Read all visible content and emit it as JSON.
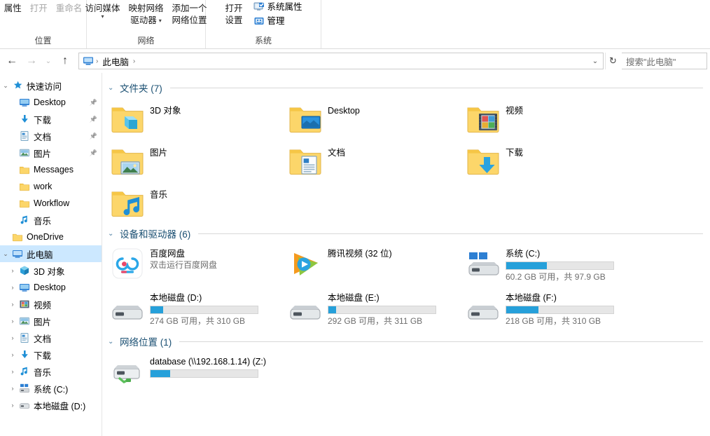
{
  "window": {
    "title": "此电脑"
  },
  "ribbon": {
    "groups": [
      {
        "name": "location",
        "label": "位置",
        "buttons": [
          {
            "label": "属性",
            "disabled": false,
            "has_caret": false
          },
          {
            "label": "打开",
            "disabled": true,
            "has_caret": false
          },
          {
            "label": "重命名",
            "disabled": true,
            "has_caret": false
          }
        ]
      },
      {
        "name": "network",
        "label": "网络",
        "buttons": [
          {
            "label_line1": "访问媒体",
            "label_line2": "",
            "has_caret": true
          },
          {
            "label_line1": "映射网络",
            "label_line2": "驱动器",
            "has_caret": true
          },
          {
            "label_line1": "添加一个",
            "label_line2": "网络位置",
            "has_caret": false
          }
        ]
      },
      {
        "name": "system",
        "label": "系统",
        "big_button": {
          "label_line1": "打开",
          "label_line2": "设置"
        },
        "small_buttons": [
          {
            "label": "系统属性",
            "icon": "system-properties-icon"
          },
          {
            "label": "管理",
            "icon": "manage-icon"
          }
        ]
      }
    ]
  },
  "addressbar": {
    "back_icon": "back-arrow-icon",
    "forward_icon": "forward-arrow-icon",
    "recent_icon": "chevron-down-icon",
    "up_icon": "up-arrow-icon",
    "path_icon": "this-pc-icon",
    "crumbs": [
      "此电脑"
    ],
    "dropdown_icon": "chevron-down-icon",
    "refresh_icon": "refresh-icon",
    "search_placeholder": "搜索\"此电脑\""
  },
  "navpane": {
    "items": [
      {
        "label": "快速访问",
        "icon": "star-icon",
        "chevron": "open",
        "indent": 0,
        "pinned": false,
        "selected": false
      },
      {
        "label": "Desktop",
        "icon": "desktop-icon",
        "chevron": "none",
        "indent": 1,
        "pinned": true,
        "selected": false
      },
      {
        "label": "下载",
        "icon": "downloads-icon",
        "chevron": "none",
        "indent": 1,
        "pinned": true,
        "selected": false
      },
      {
        "label": "文档",
        "icon": "documents-icon",
        "chevron": "none",
        "indent": 1,
        "pinned": true,
        "selected": false
      },
      {
        "label": "图片",
        "icon": "pictures-icon",
        "chevron": "none",
        "indent": 1,
        "pinned": true,
        "selected": false
      },
      {
        "label": "Messages",
        "icon": "folder-icon",
        "chevron": "none",
        "indent": 1,
        "pinned": false,
        "selected": false
      },
      {
        "label": "work",
        "icon": "folder-icon",
        "chevron": "none",
        "indent": 1,
        "pinned": false,
        "selected": false
      },
      {
        "label": "Workflow",
        "icon": "folder-icon",
        "chevron": "none",
        "indent": 1,
        "pinned": false,
        "selected": false
      },
      {
        "label": "音乐",
        "icon": "music-icon",
        "chevron": "none",
        "indent": 1,
        "pinned": false,
        "selected": false
      },
      {
        "label": "OneDrive",
        "icon": "onedrive-folder-icon",
        "chevron": "none",
        "indent": 0,
        "pinned": false,
        "selected": false
      },
      {
        "label": "此电脑",
        "icon": "this-pc-icon",
        "chevron": "open",
        "indent": 0,
        "pinned": false,
        "selected": true
      },
      {
        "label": "3D 对象",
        "icon": "3d-objects-icon",
        "chevron": "closed",
        "indent": 1,
        "pinned": false,
        "selected": false
      },
      {
        "label": "Desktop",
        "icon": "desktop-icon",
        "chevron": "closed",
        "indent": 1,
        "pinned": false,
        "selected": false
      },
      {
        "label": "视频",
        "icon": "videos-icon",
        "chevron": "closed",
        "indent": 1,
        "pinned": false,
        "selected": false
      },
      {
        "label": "图片",
        "icon": "pictures-icon",
        "chevron": "closed",
        "indent": 1,
        "pinned": false,
        "selected": false
      },
      {
        "label": "文档",
        "icon": "documents-icon",
        "chevron": "closed",
        "indent": 1,
        "pinned": false,
        "selected": false
      },
      {
        "label": "下载",
        "icon": "downloads-icon",
        "chevron": "closed",
        "indent": 1,
        "pinned": false,
        "selected": false
      },
      {
        "label": "音乐",
        "icon": "music-icon",
        "chevron": "closed",
        "indent": 1,
        "pinned": false,
        "selected": false
      },
      {
        "label": "系统 (C:)",
        "icon": "windows-drive-icon",
        "chevron": "closed",
        "indent": 1,
        "pinned": false,
        "selected": false
      },
      {
        "label": "本地磁盘 (D:)",
        "icon": "drive-icon",
        "chevron": "closed",
        "indent": 1,
        "pinned": false,
        "selected": false
      }
    ]
  },
  "content": {
    "groups": [
      {
        "name": "folders",
        "title": "文件夹 (7)",
        "chevron": "open",
        "items": [
          {
            "name": "3D 对象",
            "icon": "folder-3d-objects-icon",
            "type": "folder"
          },
          {
            "name": "Desktop",
            "icon": "folder-desktop-icon",
            "type": "folder"
          },
          {
            "name": "视频",
            "icon": "folder-videos-icon",
            "type": "folder"
          },
          {
            "name": "图片",
            "icon": "folder-pictures-icon",
            "type": "folder"
          },
          {
            "name": "文档",
            "icon": "folder-documents-icon",
            "type": "folder"
          },
          {
            "name": "下载",
            "icon": "folder-downloads-icon",
            "type": "folder"
          },
          {
            "name": "音乐",
            "icon": "folder-music-icon",
            "type": "folder"
          }
        ]
      },
      {
        "name": "devices-and-drives",
        "title": "设备和驱动器 (6)",
        "chevron": "open",
        "items": [
          {
            "name": "百度网盘",
            "sub": "双击运行百度网盘",
            "icon": "baidu-netdisk-icon",
            "type": "app"
          },
          {
            "name": "腾讯视频 (32 位)",
            "sub": "",
            "icon": "tencent-video-icon",
            "type": "app"
          },
          {
            "name": "系统 (C:)",
            "sub": "60.2 GB 可用，共 97.9 GB",
            "icon": "windows-drive-icon",
            "type": "drive",
            "fill_percent": 38
          },
          {
            "name": "本地磁盘 (D:)",
            "sub": "274 GB 可用，共 310 GB",
            "icon": "drive-icon",
            "type": "drive",
            "fill_percent": 12
          },
          {
            "name": "本地磁盘 (E:)",
            "sub": "292 GB 可用，共 311 GB",
            "icon": "drive-icon",
            "type": "drive",
            "fill_percent": 7
          },
          {
            "name": "本地磁盘 (F:)",
            "sub": "218 GB 可用，共 310 GB",
            "icon": "drive-icon",
            "type": "drive",
            "fill_percent": 30
          }
        ]
      },
      {
        "name": "network-locations",
        "title": "网络位置 (1)",
        "chevron": "open",
        "items": [
          {
            "name": "database (\\\\192.168.1.14) (Z:)",
            "sub": "",
            "icon": "network-drive-icon",
            "type": "netdrive",
            "fill_percent": 18
          }
        ]
      }
    ]
  },
  "colors": {
    "accent_bar": "#26a0da",
    "selection": "#cce8ff",
    "group_title": "#1a4f72",
    "folder_yellow": "#ffd666"
  }
}
